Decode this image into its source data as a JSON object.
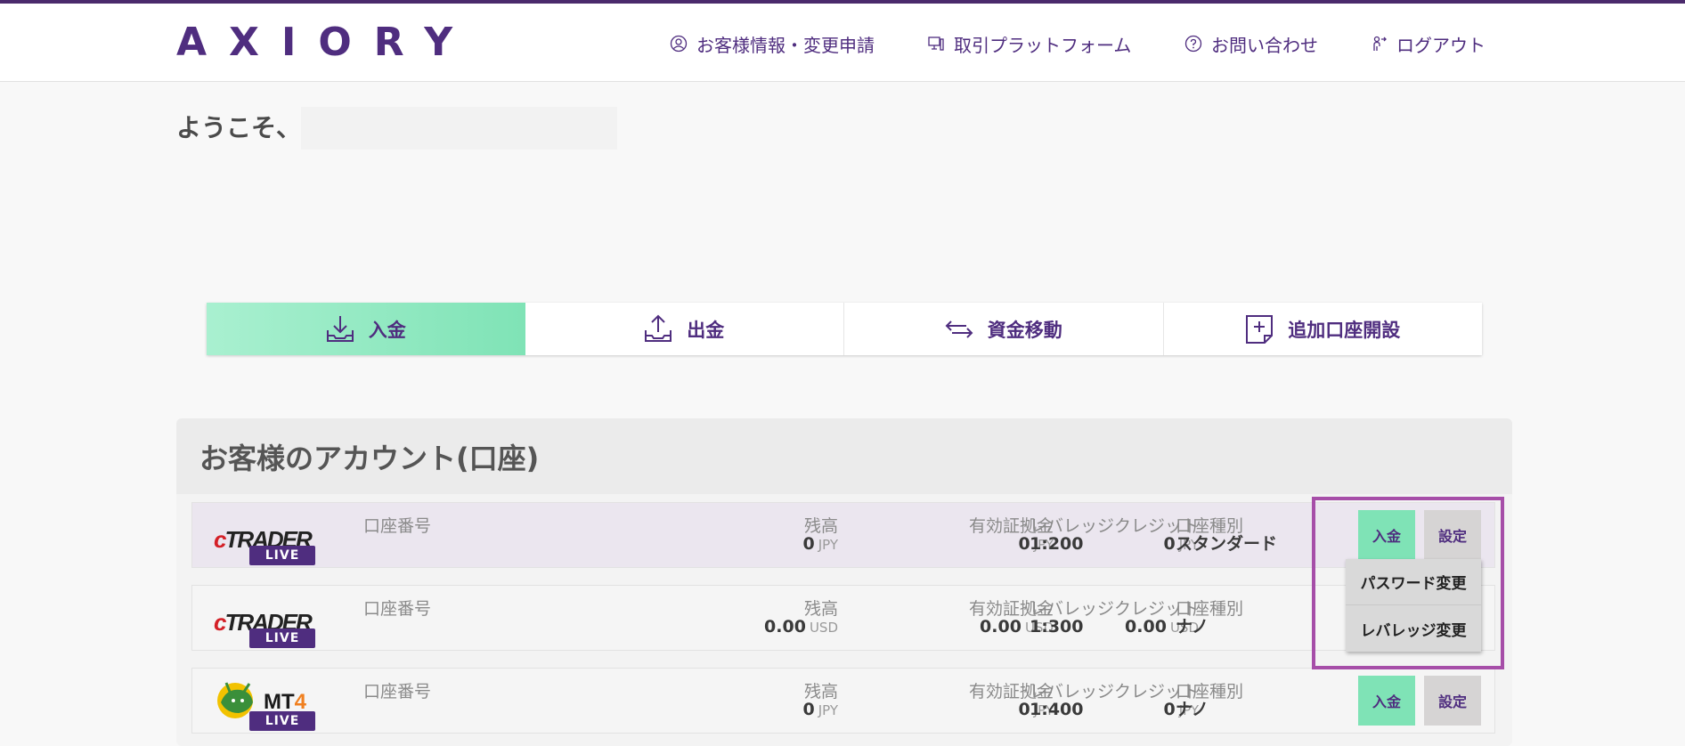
{
  "header": {
    "logo": "AXIORY",
    "nav": [
      {
        "label": "お客様情報・変更申請",
        "icon": "user-circle-icon"
      },
      {
        "label": "取引プラットフォーム",
        "icon": "monitor-icon"
      },
      {
        "label": "お問い合わせ",
        "icon": "question-circle-icon"
      },
      {
        "label": "ログアウト",
        "icon": "logout-icon"
      }
    ]
  },
  "welcome": "ようこそ、",
  "actions": [
    {
      "label": "入金",
      "icon": "download-tray-icon"
    },
    {
      "label": "出金",
      "icon": "upload-tray-icon"
    },
    {
      "label": "資金移動",
      "icon": "transfer-arrows-icon"
    },
    {
      "label": "追加口座開設",
      "icon": "add-document-icon"
    }
  ],
  "accounts_title": "お客様のアカウント(口座)",
  "labels": {
    "account_number": "口座番号",
    "balance": "残高",
    "equity": "有効証拠金",
    "credit": "クレジット",
    "leverage": "レバレッジ",
    "type": "口座種別",
    "live": "LIVE",
    "deposit_btn": "入金",
    "settings_btn": "設定"
  },
  "accounts": [
    {
      "platform": "cTrader",
      "balance": "0",
      "balance_unit": "JPY",
      "equity": "0",
      "equity_unit": "JPY",
      "credit": "0",
      "credit_unit": "JPY",
      "leverage": "1:200",
      "type": "スタンダード"
    },
    {
      "platform": "cTrader",
      "balance": "0.00",
      "balance_unit": "USD",
      "equity": "0.00",
      "equity_unit": "USD",
      "credit": "0.00",
      "credit_unit": "USD",
      "leverage": "1:300",
      "type": "ナノ"
    },
    {
      "platform": "MT4",
      "balance": "0",
      "balance_unit": "JPY",
      "equity": "0",
      "equity_unit": "JPY",
      "credit": "0",
      "credit_unit": "JPY",
      "leverage": "1:400",
      "type": "ナノ"
    }
  ],
  "platform_logos": {
    "ctrader_c": "c",
    "ctrader_rest": "TRADER",
    "mt4_mt": "MT",
    "mt4_4": "4"
  },
  "settings_menu": [
    "パスワード変更",
    "レバレッジ変更"
  ],
  "colors": {
    "brand": "#4f2d7f",
    "accent_green": "#7fe3b6",
    "callout": "#a64ea8"
  }
}
